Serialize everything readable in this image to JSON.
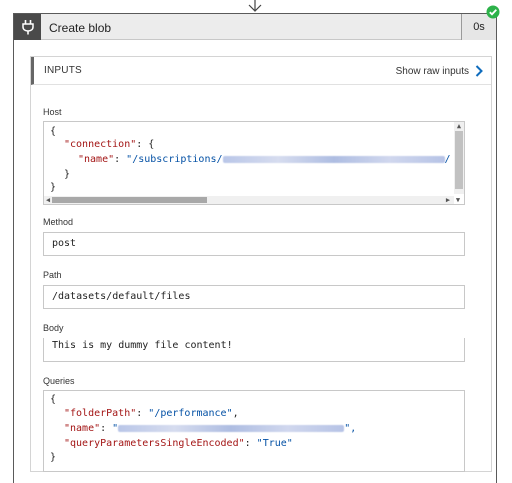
{
  "card": {
    "title": "Create blob",
    "duration": "0s",
    "status": "succeeded"
  },
  "inputs": {
    "title": "INPUTS",
    "show_raw_label": "Show raw inputs"
  },
  "fields": {
    "host": {
      "label": "Host",
      "lines": {
        "l1": "{",
        "l2_key": "\"connection\"",
        "l2_rest": ": {",
        "l3_key": "\"name\"",
        "l3_sep": ": ",
        "l3_value": "\"/subscriptions/",
        "l3_end": "/",
        "l4": "}",
        "l5": "}"
      }
    },
    "method": {
      "label": "Method",
      "value": "post"
    },
    "path": {
      "label": "Path",
      "value": "/datasets/default/files"
    },
    "body": {
      "label": "Body",
      "value": "This is my dummy file content!"
    },
    "queries": {
      "label": "Queries",
      "lines": {
        "l1": "{",
        "l2_key": "\"folderPath\"",
        "l2_sep": ": ",
        "l2_value": "\"/performance\"",
        "l2_end": ",",
        "l3_key": "\"name\"",
        "l3_sep": ": ",
        "l3_value": "\"",
        "l3_end": "\",",
        "l4_key": "\"queryParametersSingleEncoded\"",
        "l4_sep": ": ",
        "l4_value": "\"True\"",
        "l5": "}"
      }
    }
  },
  "colors": {
    "json_key": "#a31515",
    "json_string": "#0451a5",
    "status_green": "#2db24a"
  }
}
